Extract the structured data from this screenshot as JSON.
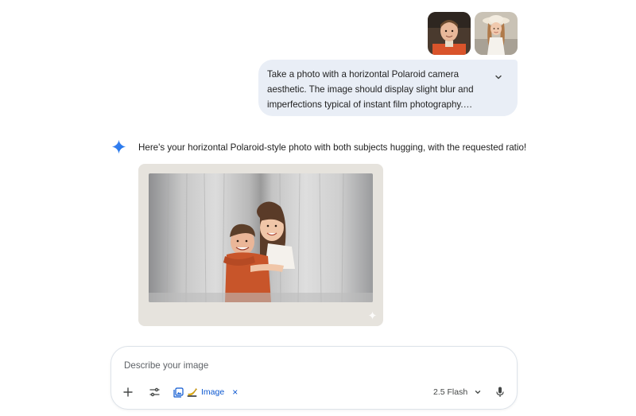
{
  "attachments": [
    {
      "name": "boy-photo"
    },
    {
      "name": "girl-photo"
    }
  ],
  "user_message": {
    "text": "Take a photo with a horizontal Polaroid camera aesthetic. The image should display slight blur and imperfections typical of instant film photography. Use...",
    "expand_icon": "chevron-down-icon"
  },
  "response": {
    "icon": "gemini-spark-icon",
    "text": "Here's your horizontal Polaroid-style photo with both subjects hugging, with the requested ratio!",
    "image": {
      "watermark_icon": "spark-watermark-icon"
    }
  },
  "composer": {
    "placeholder": "Describe your image",
    "value": "",
    "image_chip": {
      "label": "Image",
      "close": "×"
    },
    "model": {
      "label": "2.5 Flash"
    }
  },
  "colors": {
    "bubble": "#e9eef6",
    "accent": "#0b57d0",
    "spark": "#4285f4"
  }
}
